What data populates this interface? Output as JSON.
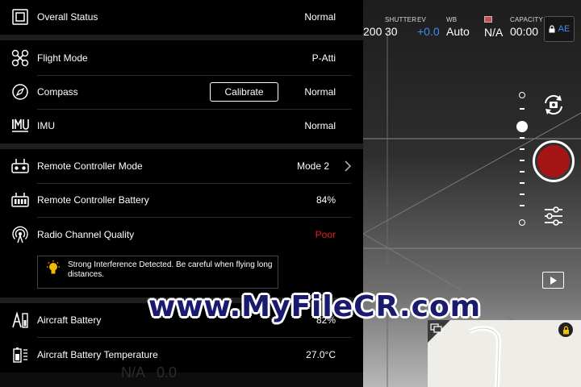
{
  "camera": {
    "iso_partial": "200",
    "shutter": {
      "label": "SHUTTER",
      "value": "30"
    },
    "ev": {
      "label": "EV",
      "value": "+0.0"
    },
    "wb": {
      "label": "WB",
      "value": "Auto"
    },
    "storage": {
      "value": "N/A"
    },
    "capacity": {
      "label": "CAPACITY",
      "value": "00:00"
    },
    "ae_label": "AE",
    "ghost_text": "N/A   0.0"
  },
  "status": {
    "overall": {
      "label": "Overall Status",
      "value": "Normal"
    },
    "flight_mode": {
      "label": "Flight Mode",
      "value": "P-Atti"
    },
    "compass": {
      "label": "Compass",
      "value": "Normal",
      "button": "Calibrate"
    },
    "imu": {
      "label": "IMU",
      "value": "Normal"
    },
    "rc_mode": {
      "label": "Remote Controller Mode",
      "value": "Mode 2"
    },
    "rc_battery": {
      "label": "Remote Controller Battery",
      "value": "84%"
    },
    "radio": {
      "label": "Radio Channel Quality",
      "value": "Poor"
    },
    "warning": "Strong Interference Detected. Be careful when flying long distances.",
    "aircraft_battery": {
      "label": "Aircraft Battery",
      "value": "82%"
    },
    "battery_temp": {
      "label": "Aircraft Battery Temperature",
      "value": "27.0°C"
    }
  },
  "watermark": "www.MyFileCR.com",
  "colors": {
    "poor": "#e02020",
    "ev_blue": "#3b8cf5",
    "record": "#a51515"
  }
}
